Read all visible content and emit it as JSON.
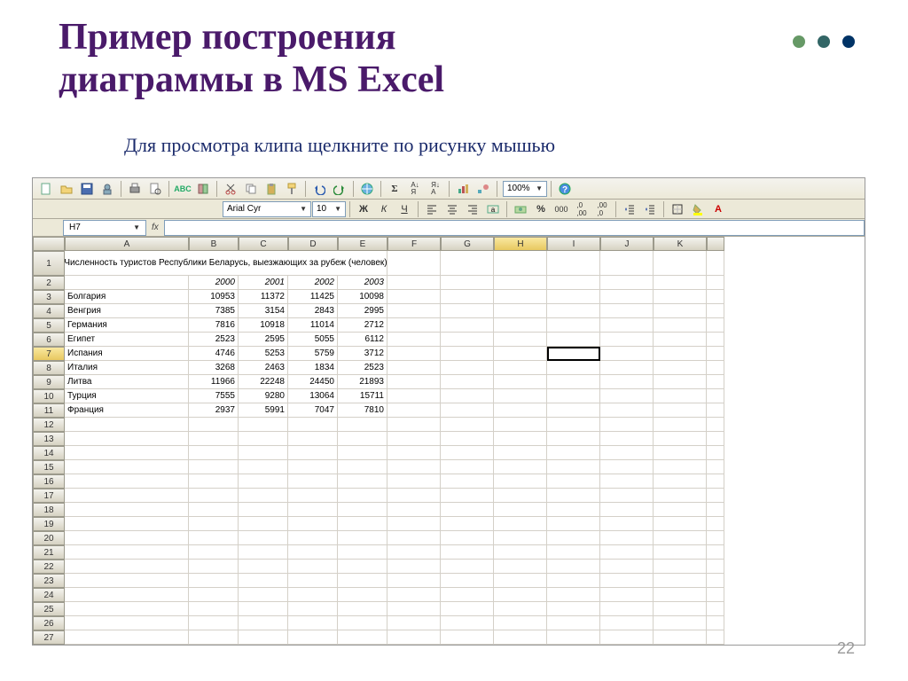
{
  "slide": {
    "title_line1": "Пример построения",
    "title_line2": "диаграммы в MS Excel",
    "instruction": "Для просмотра клипа щелкните по рисунку мышью",
    "page_number": "22"
  },
  "excel": {
    "font_name": "Arial Cyr",
    "font_size": "10",
    "zoom": "100%",
    "name_box": "H7",
    "columns": [
      "A",
      "B",
      "C",
      "D",
      "E",
      "F",
      "G",
      "H",
      "I",
      "J",
      "K"
    ],
    "table_title": "Численность туристов Республики Беларусь, выезжающих за рубеж (человек)",
    "years": [
      "2000",
      "2001",
      "2002",
      "2003"
    ],
    "rows": [
      {
        "country": "Болгария",
        "v": [
          10953,
          11372,
          11425,
          10098
        ]
      },
      {
        "country": "Венгрия",
        "v": [
          7385,
          3154,
          2843,
          2995
        ]
      },
      {
        "country": "Германия",
        "v": [
          7816,
          10918,
          11014,
          2712
        ]
      },
      {
        "country": "Египет",
        "v": [
          2523,
          2595,
          5055,
          6112
        ]
      },
      {
        "country": "Испания",
        "v": [
          4746,
          5253,
          5759,
          3712
        ]
      },
      {
        "country": "Италия",
        "v": [
          3268,
          2463,
          1834,
          2523
        ]
      },
      {
        "country": "Литва",
        "v": [
          11966,
          22248,
          24450,
          21893
        ]
      },
      {
        "country": "Турция",
        "v": [
          7555,
          9280,
          13064,
          15711
        ]
      },
      {
        "country": "Франция",
        "v": [
          2937,
          5991,
          7047,
          7810
        ]
      }
    ],
    "selected_cell": "H7",
    "selected_row": 7,
    "selected_col": "H"
  },
  "chart_data": {
    "type": "table",
    "title": "Численность туристов Республики Беларусь, выезжающих за рубеж (человек)",
    "categories": [
      "2000",
      "2001",
      "2002",
      "2003"
    ],
    "series": [
      {
        "name": "Болгария",
        "values": [
          10953,
          11372,
          11425,
          10098
        ]
      },
      {
        "name": "Венгрия",
        "values": [
          7385,
          3154,
          2843,
          2995
        ]
      },
      {
        "name": "Германия",
        "values": [
          7816,
          10918,
          11014,
          2712
        ]
      },
      {
        "name": "Египет",
        "values": [
          2523,
          2595,
          5055,
          6112
        ]
      },
      {
        "name": "Испания",
        "values": [
          4746,
          5253,
          5759,
          3712
        ]
      },
      {
        "name": "Италия",
        "values": [
          3268,
          2463,
          1834,
          2523
        ]
      },
      {
        "name": "Литва",
        "values": [
          11966,
          22248,
          24450,
          21893
        ]
      },
      {
        "name": "Турция",
        "values": [
          7555,
          9280,
          13064,
          15711
        ]
      },
      {
        "name": "Франция",
        "values": [
          2937,
          5991,
          7047,
          7810
        ]
      }
    ]
  }
}
